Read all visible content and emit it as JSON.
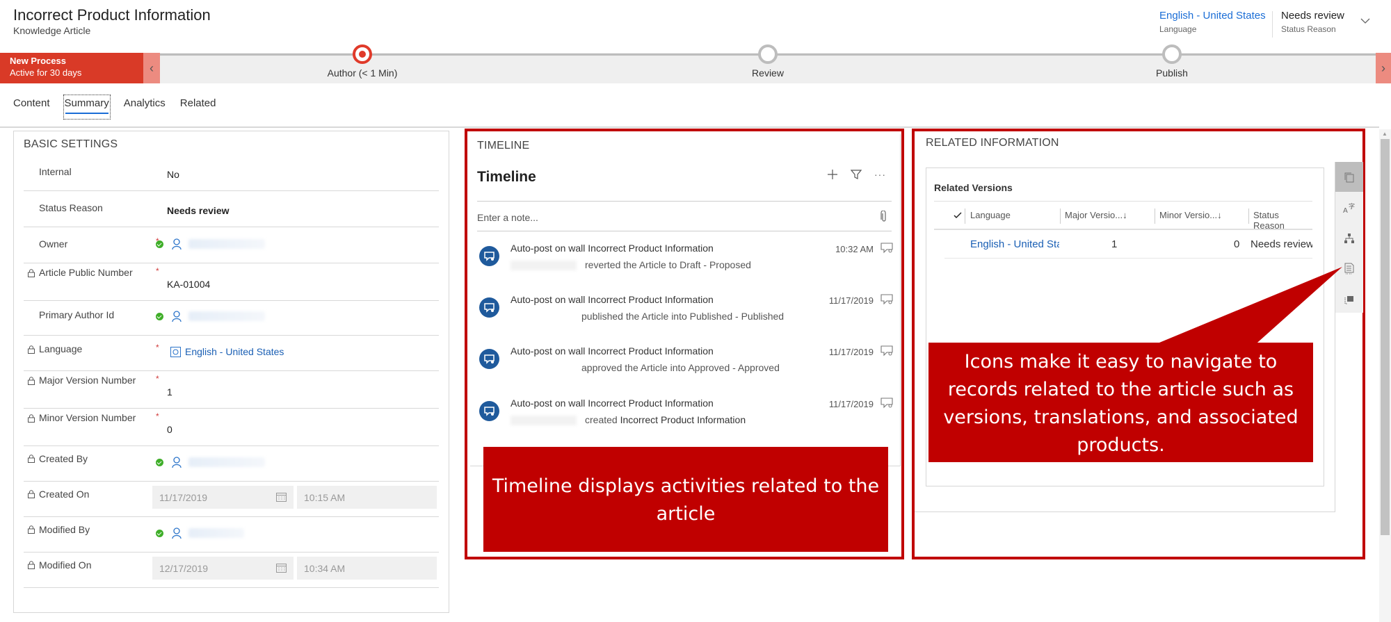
{
  "header": {
    "title": "Incorrect Product Information",
    "subtitle": "Knowledge Article",
    "language": {
      "value": "English - United States",
      "label": "Language"
    },
    "status": {
      "value": "Needs review",
      "label": "Status Reason"
    }
  },
  "process": {
    "name": "New Process",
    "duration": "Active for 30 days",
    "stages": [
      {
        "label": "Author  (< 1 Min)",
        "active": true
      },
      {
        "label": "Review",
        "active": false
      },
      {
        "label": "Publish",
        "active": false
      }
    ],
    "prev_arrow": "‹",
    "next_arrow": "›"
  },
  "tabs": [
    {
      "label": "Content",
      "active": false
    },
    {
      "label": "Summary",
      "active": true
    },
    {
      "label": "Analytics",
      "active": false
    },
    {
      "label": "Related",
      "active": false
    }
  ],
  "basic_settings": {
    "title": "BASIC SETTINGS",
    "fields": [
      {
        "label": "Internal",
        "value": "No",
        "locked": false,
        "required": false
      },
      {
        "label": "Status Reason",
        "value": "Needs review",
        "locked": false,
        "required": false
      },
      {
        "label": "Owner",
        "value": "",
        "locked": false,
        "required": true
      },
      {
        "label": "Article Public Number",
        "value": "KA-01004",
        "locked": true,
        "required": true
      },
      {
        "label": "Primary Author Id",
        "value": "",
        "locked": false,
        "required": false
      },
      {
        "label": "Language",
        "value": "English - United States",
        "locked": true,
        "required": true
      },
      {
        "label": "Major Version Number",
        "value": "1",
        "locked": true,
        "required": true
      },
      {
        "label": "Minor Version Number",
        "value": "0",
        "locked": true,
        "required": true
      },
      {
        "label": "Created By",
        "value": "",
        "locked": true,
        "required": false
      },
      {
        "label": "Created On",
        "date": "11/17/2019",
        "time": "10:15 AM",
        "locked": true,
        "required": false
      },
      {
        "label": "Modified By",
        "value": "",
        "locked": true,
        "required": false
      },
      {
        "label": "Modified On",
        "date": "12/17/2019",
        "time": "10:34 AM",
        "locked": true,
        "required": false
      }
    ],
    "required_mark": "*"
  },
  "timeline": {
    "section_title": "TIMELINE",
    "heading": "Timeline",
    "note_placeholder": "Enter a note...",
    "more_label": "···",
    "items": [
      {
        "title": "Auto-post on wall Incorrect Product Information",
        "detail": "reverted the Article to Draft - Proposed",
        "emphasis": "",
        "date": "10:32 AM"
      },
      {
        "title": "Auto-post on wall Incorrect Product Information",
        "detail": "published the Article into Published - Published",
        "emphasis": "",
        "date": "11/17/2019"
      },
      {
        "title": "Auto-post on wall Incorrect Product Information",
        "detail": "approved the Article into Approved - Approved",
        "emphasis": "",
        "date": "11/17/2019"
      },
      {
        "title": "Auto-post on wall Incorrect Product Information",
        "detail": "created",
        "emphasis": "Incorrect Product Information",
        "date": "11/17/2019"
      }
    ]
  },
  "related": {
    "section_title": "RELATED INFORMATION",
    "card_title": "Related Versions",
    "columns": [
      "Language",
      "Major Versio...↓",
      "Minor Versio...↓",
      "Status Reason"
    ],
    "rows": [
      {
        "language": "English - United States",
        "major": "1",
        "minor": "0",
        "status": "Needs review"
      }
    ],
    "nav_icons": [
      "related-versions-icon",
      "translations-icon",
      "hierarchy-icon",
      "products-icon",
      "related-articles-icon"
    ]
  },
  "annotations": {
    "timeline": "Timeline displays activities related to the article",
    "related": "Icons make it easy to navigate to records related to the article such as versions, translations, and associated products."
  },
  "colors": {
    "process_active": "#d93a27",
    "callout": "#c00000",
    "link": "#1a6dd6",
    "timeline_avatar": "#1f5a9c"
  }
}
